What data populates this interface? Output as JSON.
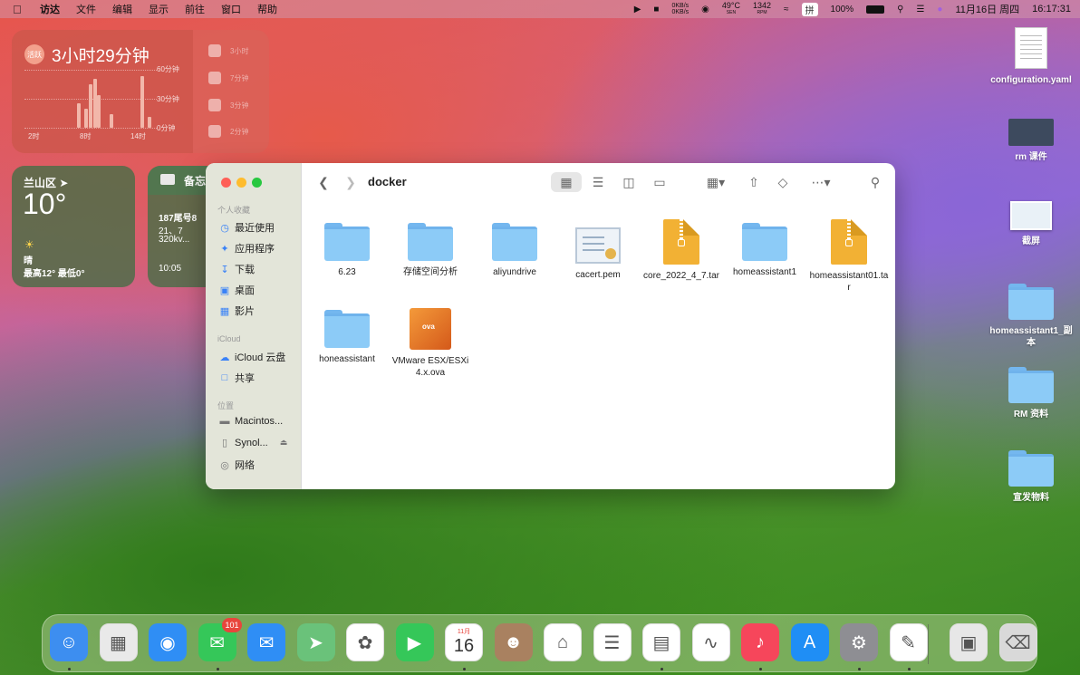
{
  "menubar": {
    "app_name": "访达",
    "menus": [
      "文件",
      "编辑",
      "显示",
      "前往",
      "窗口",
      "帮助"
    ],
    "net_up": "0KB/s",
    "net_down": "0KB/s",
    "cpu_temp": "49°C",
    "cpu_temp_label": "SEN",
    "fan_rpm": "1342",
    "fan_label": "RPM",
    "input_method": "拼",
    "battery": "100%",
    "date": "11月16日 周四",
    "time": "16:17:31"
  },
  "screen_time": {
    "badge": "活跃",
    "total": "3小时29分钟",
    "y_labels": [
      "60分钟",
      "30分钟",
      "0分钟"
    ],
    "x_labels": [
      "2时",
      "8时",
      "14时"
    ],
    "bars": [
      0.45,
      0.35,
      0.8,
      0.9,
      0.6,
      0.25,
      0.95,
      0.2
    ],
    "legend": [
      "3小时",
      "7分钟",
      "3分钟",
      "2分钟"
    ]
  },
  "weather": {
    "city": "兰山区",
    "temp": "10°",
    "condition": "晴",
    "range": "最高12° 最低0°"
  },
  "notes": {
    "title": "备忘",
    "line1": "187尾号8",
    "line2": "21、7",
    "line3": "320kv...",
    "time": "10:05"
  },
  "finder": {
    "title": "docker",
    "sidebar": {
      "favorites_title": "个人收藏",
      "favorites": [
        {
          "label": "最近使用",
          "icon": "clock-icon"
        },
        {
          "label": "应用程序",
          "icon": "apps-icon"
        },
        {
          "label": "下载",
          "icon": "download-icon"
        },
        {
          "label": "桌面",
          "icon": "desktop-icon"
        },
        {
          "label": "影片",
          "icon": "film-icon"
        }
      ],
      "icloud_title": "iCloud",
      "icloud": [
        {
          "label": "iCloud 云盘",
          "icon": "cloud-icon"
        },
        {
          "label": "共享",
          "icon": "shared-folder-icon"
        }
      ],
      "locations_title": "位置",
      "locations": [
        {
          "label": "Macintos...",
          "icon": "disk-icon"
        },
        {
          "label": "Synol...",
          "icon": "server-icon"
        },
        {
          "label": "网络",
          "icon": "network-icon"
        }
      ]
    },
    "files": [
      {
        "name": "6.23",
        "type": "folder"
      },
      {
        "name": "存储空间分析",
        "type": "folder"
      },
      {
        "name": "aliyundrive",
        "type": "folder"
      },
      {
        "name": "cacert.pem",
        "type": "cert"
      },
      {
        "name": "core_2022_4_7.tar",
        "type": "archive"
      },
      {
        "name": "homeassistant1",
        "type": "folder"
      },
      {
        "name": "homeassistant01.tar",
        "type": "archive"
      },
      {
        "name": "honeassistant",
        "type": "folder"
      },
      {
        "name": "VMware ESX/ESXi 4.x.ova",
        "type": "ova"
      }
    ],
    "ova_label": "ova"
  },
  "desktop_icons": [
    {
      "label": "configuration.yaml"
    },
    {
      "label": "rm 课件"
    },
    {
      "label": "截屏"
    },
    {
      "label": "homeassistant1_副本"
    },
    {
      "label": "RM 资料"
    },
    {
      "label": "宣发物料"
    }
  ],
  "dock": {
    "messages_badge": "101",
    "calendar_month": "11月",
    "calendar_day": "16",
    "apps": [
      {
        "name": "finder",
        "color": "#3d8ef0"
      },
      {
        "name": "launchpad",
        "color": "#e9e9e9"
      },
      {
        "name": "safari",
        "color": "#2f8ef5"
      },
      {
        "name": "messages",
        "color": "#35c759"
      },
      {
        "name": "mail",
        "color": "#2f8ef5"
      },
      {
        "name": "maps",
        "color": "#6ac27a"
      },
      {
        "name": "photos",
        "color": "#ffffff"
      },
      {
        "name": "facetime",
        "color": "#35c759"
      },
      {
        "name": "calendar",
        "color": "#ffffff"
      },
      {
        "name": "contacts",
        "color": "#a98160"
      },
      {
        "name": "home",
        "color": "#ffffff"
      },
      {
        "name": "reminders",
        "color": "#ffffff"
      },
      {
        "name": "notes",
        "color": "#ffffff"
      },
      {
        "name": "freeform",
        "color": "#ffffff"
      },
      {
        "name": "music",
        "color": "#f6465b"
      },
      {
        "name": "app-store",
        "color": "#1f8ef5"
      },
      {
        "name": "system-settings",
        "color": "#8e8e93"
      },
      {
        "name": "textedit",
        "color": "#ffffff"
      },
      {
        "name": "preview",
        "color": "#e7e7e7"
      },
      {
        "name": "trash",
        "color": "#d9d9d9"
      }
    ]
  }
}
